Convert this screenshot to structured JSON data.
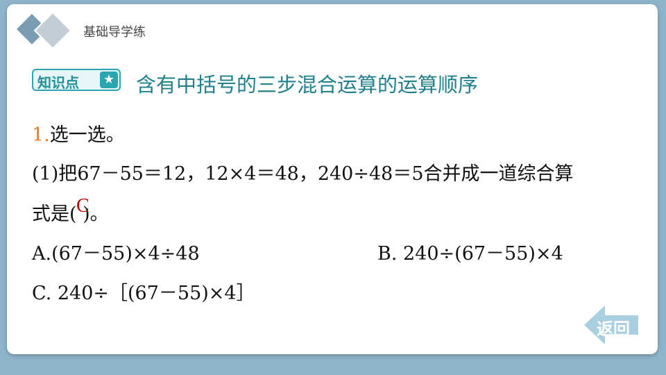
{
  "header": {
    "title": "基础导学练"
  },
  "tag": {
    "label": "知识点",
    "star": "★"
  },
  "section": {
    "title": "含有中括号的三步混合运算的运算顺序"
  },
  "question": {
    "number": "1.",
    "title": "选一选。",
    "line1": "(1)把67－55＝12，12×4＝48，240÷48＝5合并成一道综合算",
    "line2": "式是(        )。",
    "answer": "C",
    "options": {
      "a": "A.(67－55)×4÷48",
      "b": "B. 240÷(67－55)×4",
      "c": "C. 240÷［(67－55)×4］"
    }
  },
  "nav": {
    "back_label": "返回"
  },
  "colors": {
    "accent": "#2aa6b1",
    "answer": "#c00000",
    "number": "#e07b2a"
  }
}
